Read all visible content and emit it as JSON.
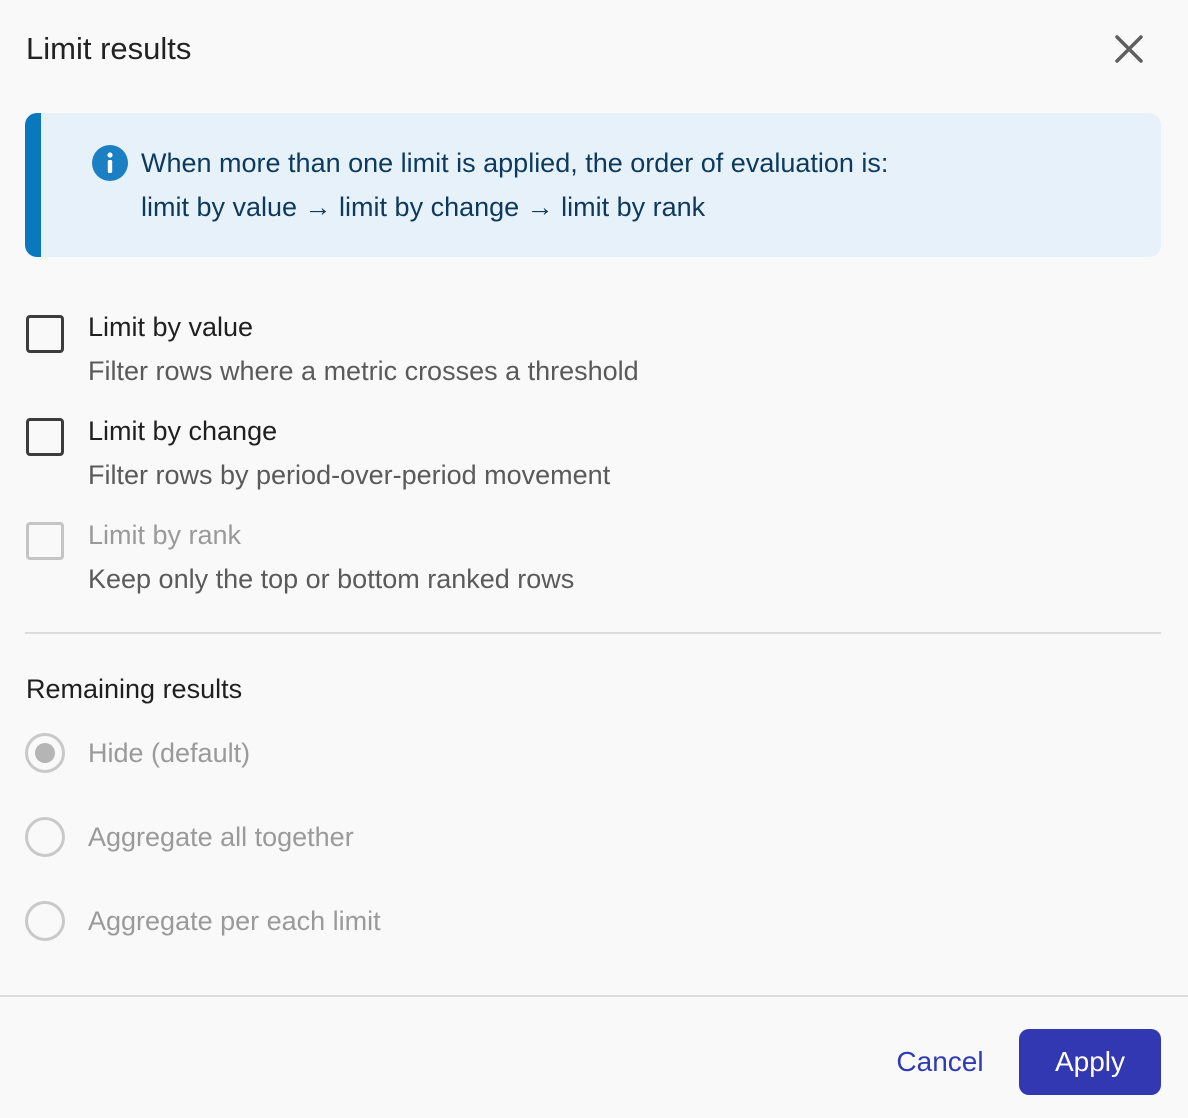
{
  "dialog": {
    "title": "Limit results"
  },
  "info": {
    "line1": "When more than one limit is applied, the order of evaluation is:",
    "line2": "limit by value → limit by change → limit by rank"
  },
  "options": [
    {
      "label": "Limit by value",
      "description": "Filter rows where a metric crosses a threshold",
      "checked": false,
      "disabled": false
    },
    {
      "label": "Limit by change",
      "description": "Filter rows by period-over-period movement",
      "checked": false,
      "disabled": false
    },
    {
      "label": "Limit by rank",
      "description": "Keep only the top or bottom ranked rows",
      "checked": false,
      "disabled": true
    }
  ],
  "remaining": {
    "title": "Remaining results",
    "options": [
      {
        "label": "Hide (default)",
        "selected": true,
        "disabled": true
      },
      {
        "label": "Aggregate all together",
        "selected": false,
        "disabled": true
      },
      {
        "label": "Aggregate per each limit",
        "selected": false,
        "disabled": true
      }
    ]
  },
  "footer": {
    "cancel_label": "Cancel",
    "apply_label": "Apply"
  },
  "colors": {
    "accent": "#3238b2",
    "info_bar": "#0a78bd",
    "info_bg": "#e6f1fa"
  }
}
